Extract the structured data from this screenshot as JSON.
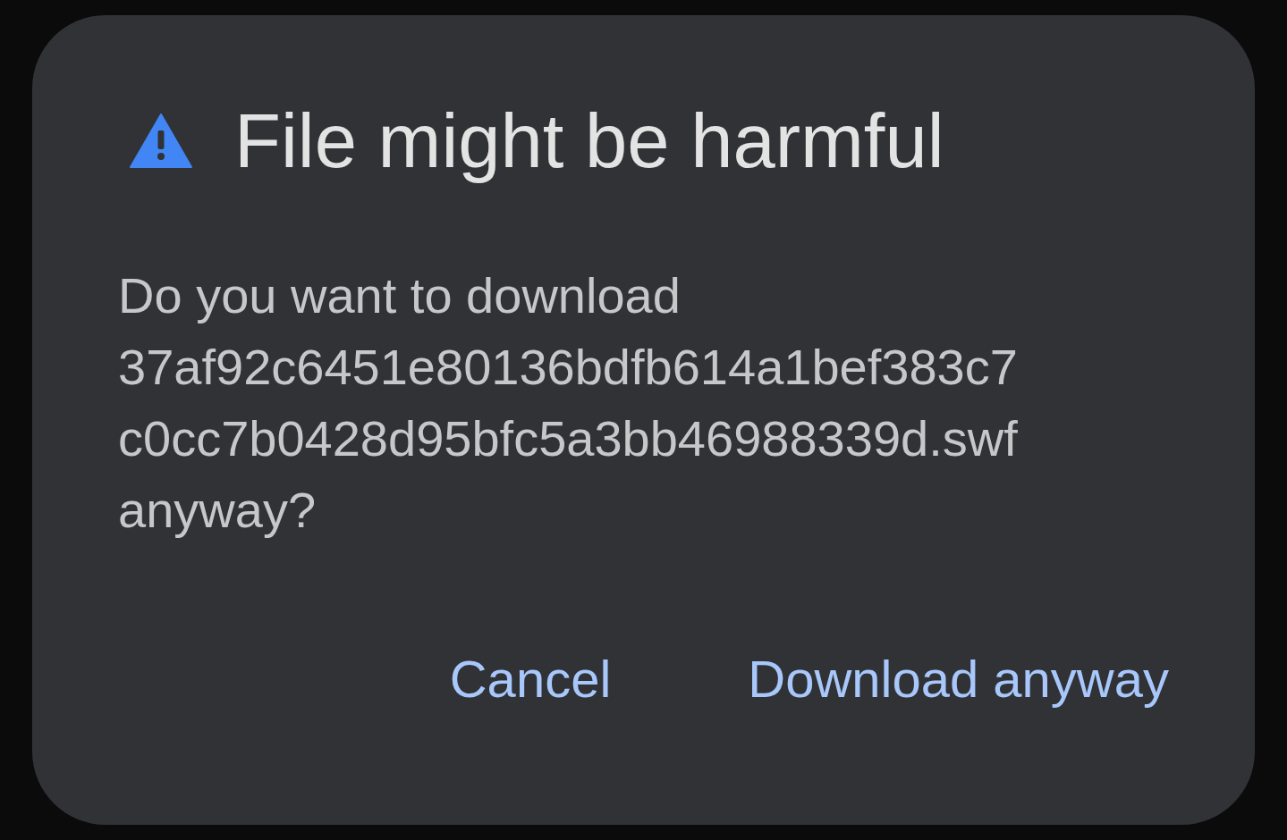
{
  "dialog": {
    "title": "File might be harmful",
    "message": "Do you want to download 37af92c6451e80136bdfb614a1bef383c7c0cc7b0428d95bfc5a3bb46988339d.swf anyway?",
    "buttons": [
      {
        "label": "Cancel"
      },
      {
        "label": "Download anyway"
      }
    ]
  }
}
